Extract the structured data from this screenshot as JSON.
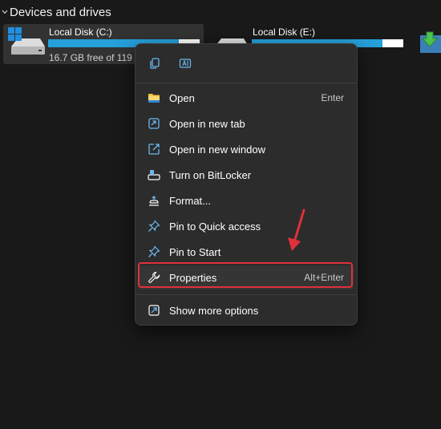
{
  "section": {
    "title": "Devices and drives",
    "expanded_icon": "chevron-down-icon"
  },
  "drives": [
    {
      "name": "Local Disk (C:)",
      "free_text": "16.7 GB free of 119 GB",
      "used_fraction": 0.86,
      "icon": "windows-drive-icon",
      "selected": true
    },
    {
      "name": "Local Disk (E:)",
      "used_fraction": 0.86,
      "icon": "drive-icon",
      "selected": false
    }
  ],
  "context_menu": {
    "top_actions": [
      {
        "name": "copy",
        "icon": "copy-icon"
      },
      {
        "name": "rename",
        "icon": "rename-icon"
      }
    ],
    "items": [
      {
        "label": "Open",
        "shortcut": "Enter",
        "icon": "folder-icon"
      },
      {
        "label": "Open in new tab",
        "shortcut": "",
        "icon": "new-tab-icon"
      },
      {
        "label": "Open in new window",
        "shortcut": "",
        "icon": "new-window-icon"
      },
      {
        "label": "Turn on BitLocker",
        "shortcut": "",
        "icon": "bitlocker-key-icon"
      },
      {
        "label": "Format...",
        "shortcut": "",
        "icon": "format-icon"
      },
      {
        "label": "Pin to Quick access",
        "shortcut": "",
        "icon": "pin-icon"
      },
      {
        "label": "Pin to Start",
        "shortcut": "",
        "icon": "pin-icon"
      },
      {
        "label": "Properties",
        "shortcut": "Alt+Enter",
        "icon": "wrench-icon",
        "highlighted": true
      }
    ],
    "more": {
      "label": "Show more options",
      "icon": "show-more-icon"
    }
  },
  "colors": {
    "accent": "#26a0da",
    "annotation": "#e0313b",
    "menu_bg": "#2c2c2c",
    "page_bg": "#191919"
  }
}
